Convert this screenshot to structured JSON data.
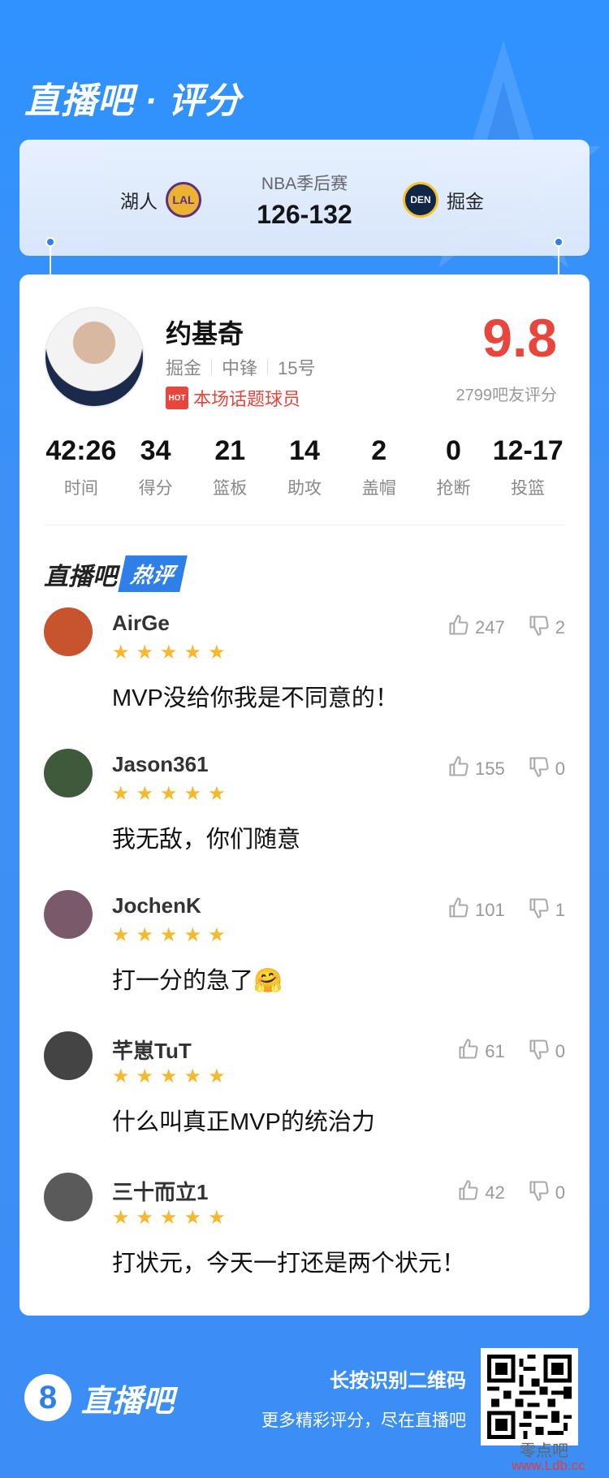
{
  "header": {
    "title": "直播吧 · 评分"
  },
  "match": {
    "league": "NBA季后赛",
    "score": "126-132",
    "home": {
      "name": "湖人",
      "abbr": "LAL"
    },
    "away": {
      "name": "掘金",
      "abbr": "DEN"
    }
  },
  "player": {
    "name": "约基奇",
    "team": "掘金",
    "position": "中锋",
    "number": "15号",
    "hot_badge": "HOT",
    "hot_label": "本场话题球员",
    "rating": "9.8",
    "rating_count": "2799吧友评分"
  },
  "stats": [
    {
      "value": "42:26",
      "label": "时间"
    },
    {
      "value": "34",
      "label": "得分"
    },
    {
      "value": "21",
      "label": "篮板"
    },
    {
      "value": "14",
      "label": "助攻"
    },
    {
      "value": "2",
      "label": "盖帽"
    },
    {
      "value": "0",
      "label": "抢断"
    },
    {
      "value": "12-17",
      "label": "投篮"
    }
  ],
  "hot_comments": {
    "title": "直播吧",
    "badge": "热评",
    "items": [
      {
        "user": "AirGe",
        "stars": 5,
        "text": "MVP没给你我是不同意的！",
        "likes": "247",
        "dislikes": "2",
        "avatar_color": "#c7532f"
      },
      {
        "user": "Jason361",
        "stars": 5,
        "text": "我无敌，你们随意",
        "likes": "155",
        "dislikes": "0",
        "avatar_color": "#3e5a3a"
      },
      {
        "user": "JochenK",
        "stars": 5,
        "text": "打一分的急了🤗",
        "likes": "101",
        "dislikes": "1",
        "avatar_color": "#7a5a6a"
      },
      {
        "user": "芊崽TuT",
        "stars": 5,
        "text": "什么叫真正MVP的统治力",
        "likes": "61",
        "dislikes": "0",
        "avatar_color": "#444444"
      },
      {
        "user": "三十而立1",
        "stars": 5,
        "text": "打状元，今天一打还是两个状元！",
        "likes": "42",
        "dislikes": "0",
        "avatar_color": "#5a5a5a"
      }
    ]
  },
  "footer": {
    "logo_mark": "8",
    "logo_text": "直播吧",
    "cta_main": "长按识别二维码",
    "cta_sub": "更多精彩评分，尽在直播吧",
    "watermark": "零点吧",
    "watermark_url": "www.Ldb.cc"
  },
  "colors": {
    "accent": "#2e7fe8",
    "rating": "#e8453c",
    "star": "#f5b82e"
  }
}
